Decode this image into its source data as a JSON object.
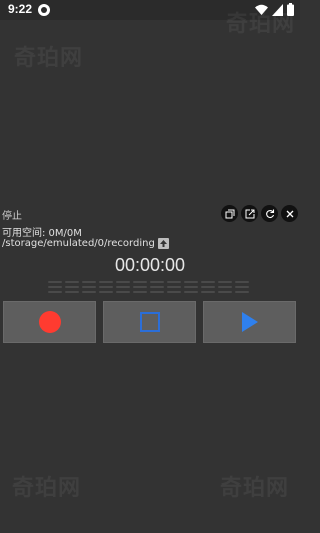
{
  "status_bar": {
    "time": "9:22",
    "icons": [
      "notification-icon",
      "wifi-icon",
      "cellular-icon",
      "battery-icon"
    ]
  },
  "recorder": {
    "state": "停止",
    "free_space": "可用空间: 0M/0M",
    "path": "/storage/emulated/0/recording",
    "timer": "00:00:00",
    "level_meter": 0
  },
  "window_controls": [
    "copy-icon",
    "share-icon",
    "refresh-icon",
    "close-icon"
  ],
  "controls": {
    "record": "record-icon",
    "stop": "stop-icon",
    "play": "play-icon"
  },
  "watermark": "奇珀网",
  "colors": {
    "background": "#333333",
    "record": "#ff3b30",
    "stop": "#2b6ed8",
    "play": "#2f80ed",
    "button": "#5e5e5e"
  }
}
